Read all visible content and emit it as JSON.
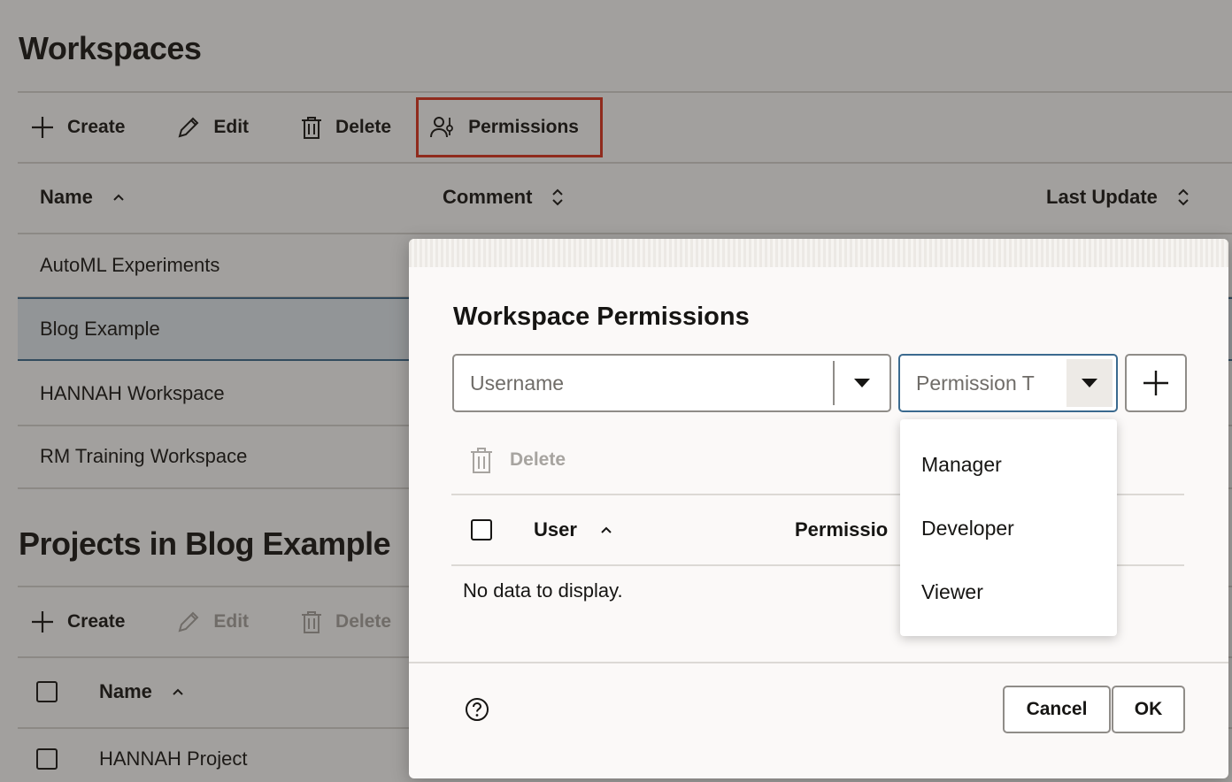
{
  "workspaces": {
    "title": "Workspaces",
    "toolbar": {
      "create": "Create",
      "edit": "Edit",
      "delete": "Delete",
      "permissions": "Permissions"
    },
    "columns": {
      "name": "Name",
      "comment": "Comment",
      "last_update": "Last Update"
    },
    "rows": [
      "AutoML Experiments",
      "Blog Example",
      "HANNAH Workspace",
      "RM Training Workspace"
    ]
  },
  "projects": {
    "title": "Projects in Blog Example",
    "toolbar": {
      "create": "Create",
      "edit": "Edit",
      "delete": "Delete"
    },
    "columns": {
      "name": "Name"
    },
    "rows": [
      "HANNAH Project"
    ]
  },
  "dialog": {
    "title": "Workspace Permissions",
    "username_placeholder": "Username",
    "permission_placeholder": "Permission T",
    "delete_label": "Delete",
    "columns": {
      "user": "User",
      "permission": "Permissio"
    },
    "empty": "No data to display.",
    "cancel": "Cancel",
    "ok": "OK"
  },
  "permission_options": [
    "Manager",
    "Developer",
    "Viewer"
  ],
  "colors": {
    "highlight": "#e0321d",
    "selected_row": "#3b6a8f"
  }
}
